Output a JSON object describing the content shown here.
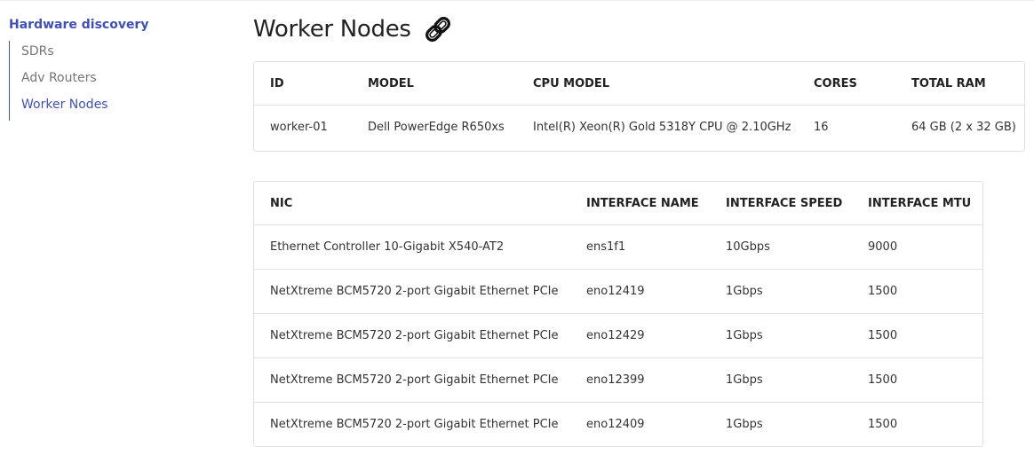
{
  "sidebar": {
    "title": "Hardware discovery",
    "items": [
      {
        "label": "SDRs",
        "active": false
      },
      {
        "label": "Adv Routers",
        "active": false
      },
      {
        "label": "Worker Nodes",
        "active": true
      }
    ]
  },
  "page": {
    "title": "Worker Nodes",
    "title_icon": "chain-link-icon"
  },
  "nodes_table": {
    "headers": [
      "ID",
      "MODEL",
      "CPU MODEL",
      "CORES",
      "TOTAL RAM"
    ],
    "rows": [
      [
        "worker-01",
        "Dell PowerEdge R650xs",
        "Intel(R) Xeon(R) Gold 5318Y CPU @ 2.10GHz",
        "16",
        "64 GB (2 x 32 GB)"
      ]
    ]
  },
  "nic_table": {
    "headers": [
      "NIC",
      "INTERFACE NAME",
      "INTERFACE SPEED",
      "INTERFACE MTU"
    ],
    "rows": [
      [
        "Ethernet Controller 10-Gigabit X540-AT2",
        "ens1f1",
        "10Gbps",
        "9000"
      ],
      [
        "NetXtreme BCM5720 2-port Gigabit Ethernet PCIe",
        "eno12419",
        "1Gbps",
        "1500"
      ],
      [
        "NetXtreme BCM5720 2-port Gigabit Ethernet PCIe",
        "eno12429",
        "1Gbps",
        "1500"
      ],
      [
        "NetXtreme BCM5720 2-port Gigabit Ethernet PCIe",
        "eno12399",
        "1Gbps",
        "1500"
      ],
      [
        "NetXtreme BCM5720 2-port Gigabit Ethernet PCIe",
        "eno12409",
        "1Gbps",
        "1500"
      ]
    ]
  },
  "colors": {
    "accent": "#3f51b5",
    "muted_text": "#757575",
    "border": "#e0e0e0"
  }
}
